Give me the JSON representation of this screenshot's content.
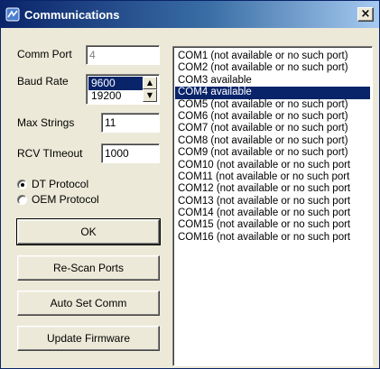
{
  "window": {
    "title": "Communications",
    "close_label": "×"
  },
  "comm_port": {
    "label": "Comm Port",
    "value": "4"
  },
  "baud_rate": {
    "label": "Baud Rate",
    "options": [
      "9600",
      "19200"
    ],
    "selected": "9600"
  },
  "max_strings": {
    "label": "Max Strings",
    "value": "11"
  },
  "rcv_timeout": {
    "label": "RCV TImeout",
    "value": "1000"
  },
  "protocol": {
    "options": [
      {
        "label": "DT Protocol",
        "checked": true
      },
      {
        "label": "OEM Protocol",
        "checked": false
      }
    ]
  },
  "buttons": {
    "ok": "OK",
    "rescan": "Re-Scan Ports",
    "auto_set": "Auto Set Comm",
    "update_firmware": "Update Firmware"
  },
  "ports": [
    {
      "label": "COM1  (not available or no such port)",
      "selected": false
    },
    {
      "label": "COM2  (not available or no such port)",
      "selected": false
    },
    {
      "label": "COM3  available",
      "selected": false
    },
    {
      "label": "COM4  available",
      "selected": true
    },
    {
      "label": "COM5  (not available or no such port)",
      "selected": false
    },
    {
      "label": "COM6  (not available or no such port)",
      "selected": false
    },
    {
      "label": "COM7  (not available or no such port)",
      "selected": false
    },
    {
      "label": "COM8  (not available or no such port)",
      "selected": false
    },
    {
      "label": "COM9  (not available or no such port)",
      "selected": false
    },
    {
      "label": "COM10  (not available or no such port",
      "selected": false
    },
    {
      "label": "COM11  (not available or no such port",
      "selected": false
    },
    {
      "label": "COM12  (not available or no such port",
      "selected": false
    },
    {
      "label": "COM13  (not available or no such port",
      "selected": false
    },
    {
      "label": "COM14  (not available or no such port",
      "selected": false
    },
    {
      "label": "COM15  (not available or no such port",
      "selected": false
    },
    {
      "label": "COM16  (not available or no such port",
      "selected": false
    }
  ]
}
